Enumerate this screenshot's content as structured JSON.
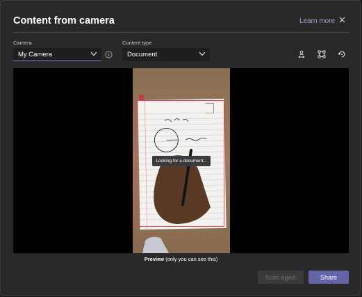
{
  "dialog": {
    "title": "Content from camera",
    "learn_more": "Learn more"
  },
  "camera": {
    "label": "Camera",
    "selected": "My Camera"
  },
  "content_type": {
    "label": "Content type",
    "selected": "Document"
  },
  "preview": {
    "status": "Looking for a document...",
    "caption_bold": "Preview",
    "caption_rest": " (only you can see this)"
  },
  "actions": {
    "scan_again": "Scan again",
    "share": "Share"
  },
  "colors": {
    "accent": "#6264a7",
    "focus_underline": "#7f85f5",
    "scan_outline": "#e0405c"
  }
}
